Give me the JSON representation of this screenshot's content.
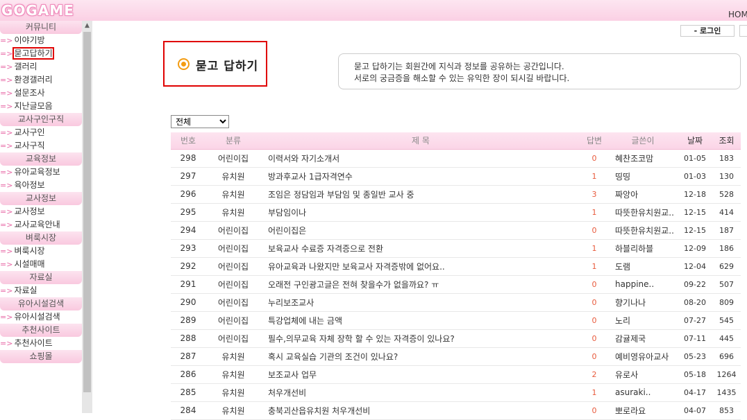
{
  "header": {
    "logo": "GOGAME",
    "home_link": "HOM"
  },
  "sidebar": {
    "sections": [
      {
        "header": "커뮤니티",
        "items": [
          "이야기방",
          "묻고답하기",
          "갤러리",
          "환경갤러리",
          "설문조사",
          "지난글모음"
        ]
      },
      {
        "header": "교사구인구직",
        "items": [
          "교사구인",
          "교사구직"
        ]
      },
      {
        "header": "교육정보",
        "items": [
          "유아교육정보",
          "육아정보"
        ]
      },
      {
        "header": "교사정보",
        "items": [
          "교사정보",
          "교사교육안내"
        ]
      },
      {
        "header": "벼룩시장",
        "items": [
          "벼룩시장",
          "시설매매"
        ]
      },
      {
        "header": "자료실",
        "items": [
          "자료실"
        ]
      },
      {
        "header": "유아시설검색",
        "items": [
          "유아시설검색"
        ]
      },
      {
        "header": "추천사이트",
        "items": [
          "추천사이트"
        ]
      },
      {
        "header": "쇼핑몰",
        "items": []
      }
    ],
    "arrow": "=>"
  },
  "login_label": "로그인",
  "page_title": "묻고 답하기",
  "description": {
    "line1": "묻고 답하기는 회원간에 지식과 정보를 공유하는 공간입니다.",
    "line2": "서로의 궁금증을 해소할 수 있는 유익한 장이 되시길 바랍니다."
  },
  "filter": {
    "selected": "전체"
  },
  "table": {
    "headers": {
      "num": "번호",
      "category": "분류",
      "title": "제 목",
      "replies": "답변",
      "author": "글쓴이",
      "date": "날짜",
      "views": "조회"
    },
    "rows": [
      {
        "num": "298",
        "category": "어린이집",
        "title": "이력서와 자기소개서",
        "replies": "0",
        "author": "혜찬조코맘",
        "date": "01-05",
        "views": "183"
      },
      {
        "num": "297",
        "category": "유치원",
        "title": "방과후교사 1급자격연수",
        "replies": "1",
        "author": "띵띵",
        "date": "01-03",
        "views": "130"
      },
      {
        "num": "296",
        "category": "유치원",
        "title": "조임은 정담임과 부담임 및 종일반 교사 중",
        "replies": "3",
        "author": "짜앙아",
        "date": "12-18",
        "views": "528"
      },
      {
        "num": "295",
        "category": "유치원",
        "title": "부담임이나",
        "replies": "1",
        "author": "따뜻한유치원교..",
        "date": "12-15",
        "views": "414"
      },
      {
        "num": "294",
        "category": "어린이집",
        "title": "어린이집은",
        "replies": "0",
        "author": "따뜻한유치원교..",
        "date": "12-15",
        "views": "187"
      },
      {
        "num": "293",
        "category": "어린이집",
        "title": "보육교사 수료증 자격증으로 전환",
        "replies": "1",
        "author": "하블리하블",
        "date": "12-09",
        "views": "186"
      },
      {
        "num": "292",
        "category": "어린이집",
        "title": "유아교육과 나왔지만 보육교사 자격증밖에 없어요..",
        "replies": "1",
        "author": "도램",
        "date": "12-04",
        "views": "629"
      },
      {
        "num": "291",
        "category": "어린이집",
        "title": "오래전 구인광고글은 전혀 찾을수가 없을까요? ㅠ",
        "replies": "0",
        "author": "happine..",
        "date": "09-22",
        "views": "507"
      },
      {
        "num": "290",
        "category": "어린이집",
        "title": "누리보조교사",
        "replies": "0",
        "author": "향기나나",
        "date": "08-20",
        "views": "809"
      },
      {
        "num": "289",
        "category": "어린이집",
        "title": "특강업체에 내는 금액",
        "replies": "0",
        "author": "노리",
        "date": "07-27",
        "views": "545"
      },
      {
        "num": "288",
        "category": "어린이집",
        "title": "필수,의무교육 자체 장학 할 수 있는 자격증이 있나요?",
        "replies": "0",
        "author": "감귤제국",
        "date": "07-11",
        "views": "445"
      },
      {
        "num": "287",
        "category": "유치원",
        "title": "혹시 교육실습 기관의 조건이 있나요?",
        "replies": "0",
        "author": "예비영유아교사",
        "date": "05-23",
        "views": "696"
      },
      {
        "num": "286",
        "category": "유치원",
        "title": "보조교사 업무",
        "replies": "2",
        "author": "유로사",
        "date": "05-18",
        "views": "1264"
      },
      {
        "num": "285",
        "category": "유치원",
        "title": "처우개선비",
        "replies": "1",
        "author": "asuraki..",
        "date": "04-17",
        "views": "1435"
      },
      {
        "num": "284",
        "category": "유치원",
        "title": "충북괴산읍유치원 처우개선비",
        "replies": "0",
        "author": "뽀로라요",
        "date": "04-07",
        "views": "853"
      }
    ]
  }
}
